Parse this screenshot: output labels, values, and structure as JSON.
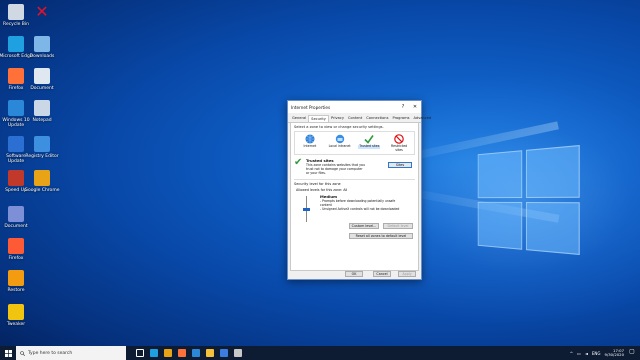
{
  "desktop": {
    "icons": [
      {
        "label": "Recycle Bin",
        "icon": "recycle-bin-icon",
        "color": "#cfd8e3"
      },
      {
        "label": "",
        "icon": "red-x-icon",
        "color": "#e81123"
      },
      {
        "label": "Microsoft Edge",
        "icon": "edge-icon",
        "color": "#1fa0e0"
      },
      {
        "label": "Downloads",
        "icon": "folder-icon",
        "color": "#7fb6e8"
      },
      {
        "label": "Firefox",
        "icon": "firefox-icon",
        "color": "#ff7139"
      },
      {
        "label": "Document",
        "icon": "document-icon",
        "color": "#dfe7f0"
      },
      {
        "label": "Windows 10 Update",
        "icon": "windows-update-icon",
        "color": "#2b88d8"
      },
      {
        "label": "Notepad",
        "icon": "notepad-icon",
        "color": "#c9d7e6"
      },
      {
        "label": "Software Update",
        "icon": "software-update-icon",
        "color": "#2a6fd1"
      },
      {
        "label": "Registry Editor",
        "icon": "registry-icon",
        "color": "#3d8fe0"
      },
      {
        "label": "Speed Up",
        "icon": "speedup-icon",
        "color": "#c0392b"
      },
      {
        "label": "Google Chrome",
        "icon": "chrome-icon",
        "color": "#e8a317"
      },
      {
        "label": "Document",
        "icon": "file-icon",
        "color": "#7d8fd6"
      },
      {
        "label": "Firefox",
        "icon": "firefox-icon-2",
        "color": "#ff5a36"
      },
      {
        "label": "Restore",
        "icon": "restore-icon",
        "color": "#f39c12"
      },
      {
        "label": "Tweaker",
        "icon": "tweaker-icon",
        "color": "#f1c40f"
      }
    ]
  },
  "dialog": {
    "title": "Internet Properties",
    "minimize": "?",
    "close": "✕",
    "tabs": [
      "General",
      "Security",
      "Privacy",
      "Content",
      "Connections",
      "Programs",
      "Advanced"
    ],
    "active_tab": "Security",
    "hint": "Select a zone to view or change security settings.",
    "zones": [
      {
        "label": "Internet",
        "icon": "globe-icon"
      },
      {
        "label": "Local intranet",
        "icon": "intranet-icon"
      },
      {
        "label": "Trusted sites",
        "icon": "check-icon"
      },
      {
        "label": "Restricted sites",
        "icon": "no-entry-icon"
      }
    ],
    "zone_title": "Trusted sites",
    "zone_desc": "This zone contains websites that you trust not to damage your computer or your files.",
    "sites_button": "Sites",
    "security_level_label": "Security level for this zone",
    "allowed_levels": "Allowed levels for this zone: All",
    "level_name": "Medium",
    "level_lines": [
      "- Prompts before downloading potentially unsafe content",
      "- Unsigned ActiveX controls will not be downloaded"
    ],
    "custom_level_button": "Custom level...",
    "default_level_button": "Default level",
    "reset_all_button": "Reset all zones to default level",
    "ok_button": "OK",
    "cancel_button": "Cancel",
    "apply_button": "Apply"
  },
  "taskbar": {
    "search_placeholder": "Type here to search",
    "pinned": [
      {
        "icon": "task-view-icon",
        "color": "#ffffff"
      },
      {
        "icon": "edge-taskbar-icon",
        "color": "#1fa0e0"
      },
      {
        "icon": "chrome-taskbar-icon",
        "color": "#e8a317"
      },
      {
        "icon": "firefox-taskbar-icon",
        "color": "#ff7139"
      },
      {
        "icon": "mail-taskbar-icon",
        "color": "#2b88d8"
      },
      {
        "icon": "file-explorer-icon",
        "color": "#f3c13a"
      },
      {
        "icon": "store-taskbar-icon",
        "color": "#3b7de0"
      },
      {
        "icon": "settings-taskbar-icon",
        "color": "#c8c8c8"
      }
    ],
    "lang": "ENG",
    "time": "17:07",
    "date": "9/30/2020"
  }
}
